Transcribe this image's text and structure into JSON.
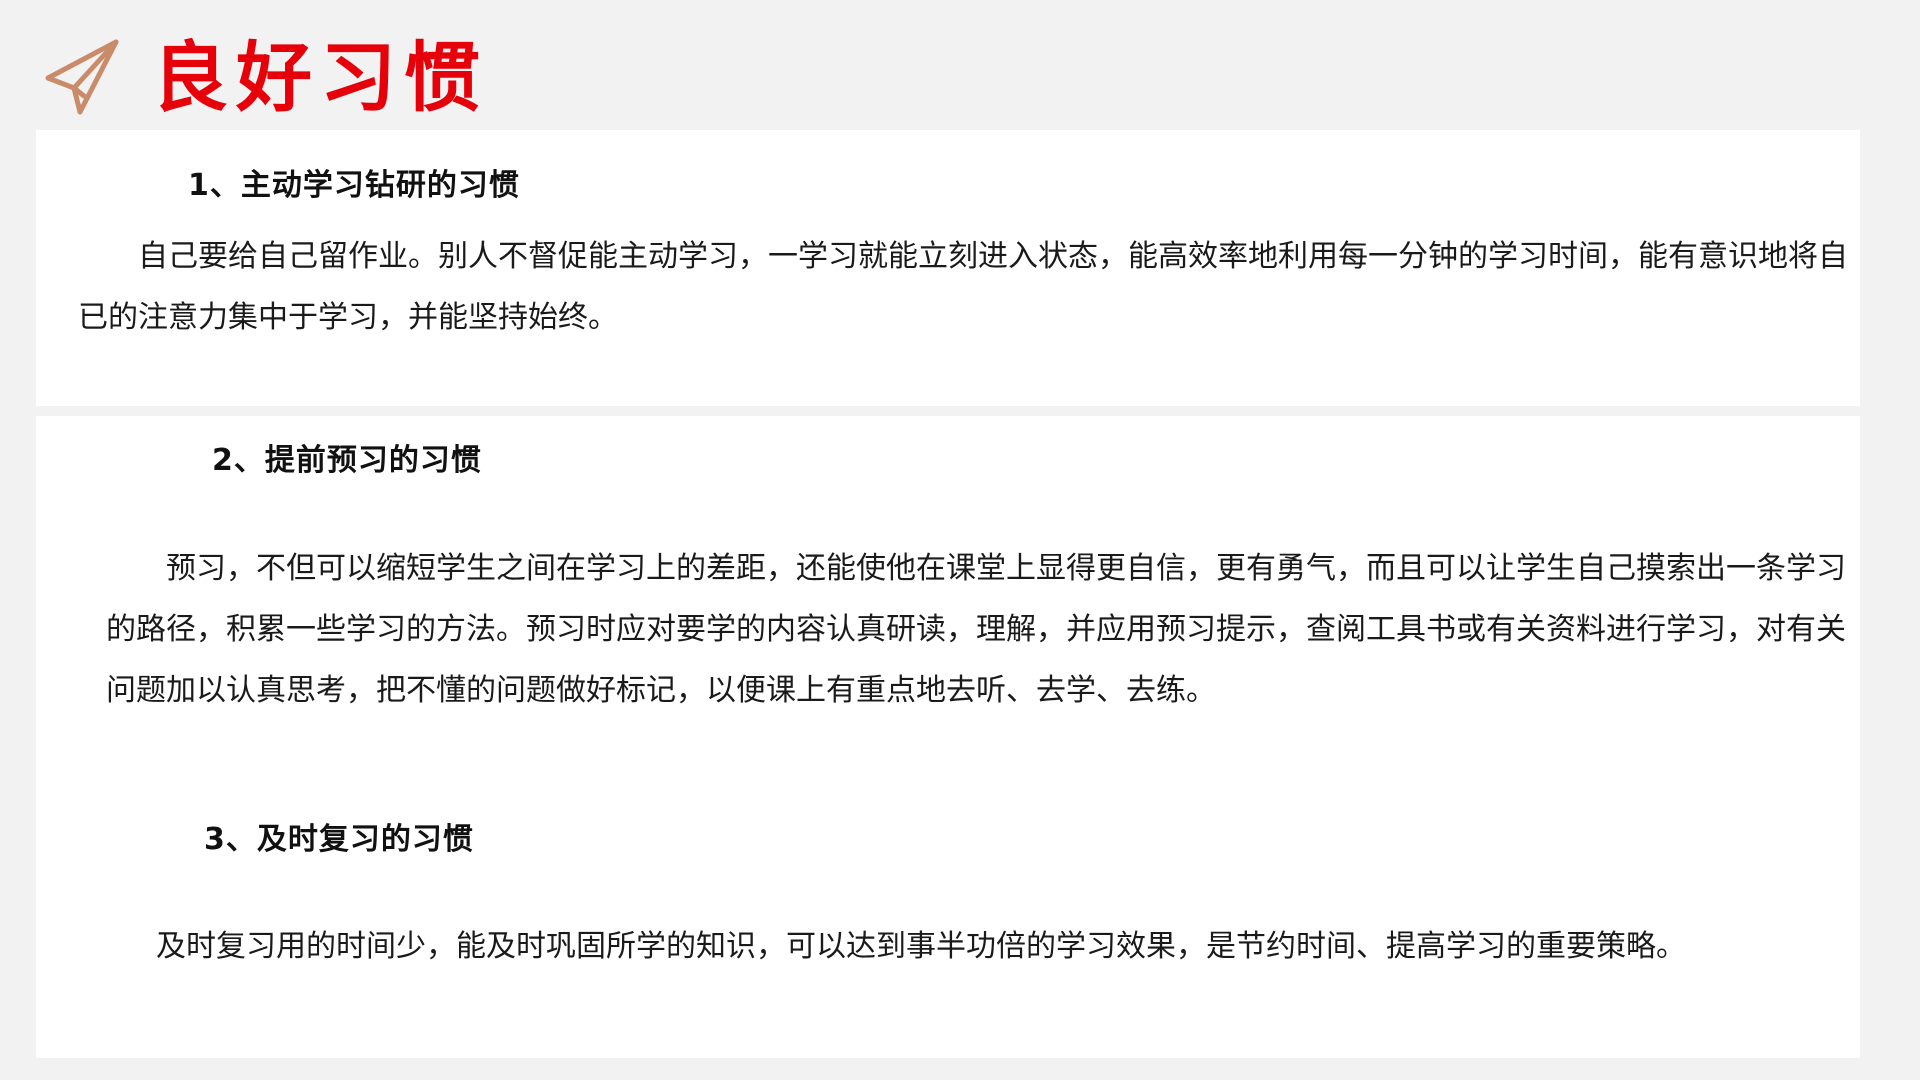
{
  "header": {
    "title": "良好习惯",
    "icon": "paper-plane-icon",
    "title_color": "#e6000a",
    "icon_color": "#c98b6a"
  },
  "sections": [
    {
      "heading": "1、主动学习钻研的习惯",
      "body": "自己要给自己留作业。别人不督促能主动学习，一学习就能立刻进入状态，能高效率地利用每一分钟的学习时间，能有意识地将自已的注意力集中于学习，并能坚持始终。"
    },
    {
      "heading": "2、提前预习的习惯",
      "body": "预习，不但可以缩短学生之间在学习上的差距，还能使他在课堂上显得更自信，更有勇气，而且可以让学生自己摸索出一条学习的路径，积累一些学习的方法。预习时应对要学的内容认真研读，理解，并应用预习提示，查阅工具书或有关资料进行学习，对有关问题加以认真思考，把不懂的问题做好标记，以便课上有重点地去听、去学、去练。"
    },
    {
      "heading": "3、及时复习的习惯",
      "body": "及时复习用的时间少，能及时巩固所学的知识，可以达到事半功倍的学习效果，是节约时间、提高学习的重要策略。"
    }
  ]
}
